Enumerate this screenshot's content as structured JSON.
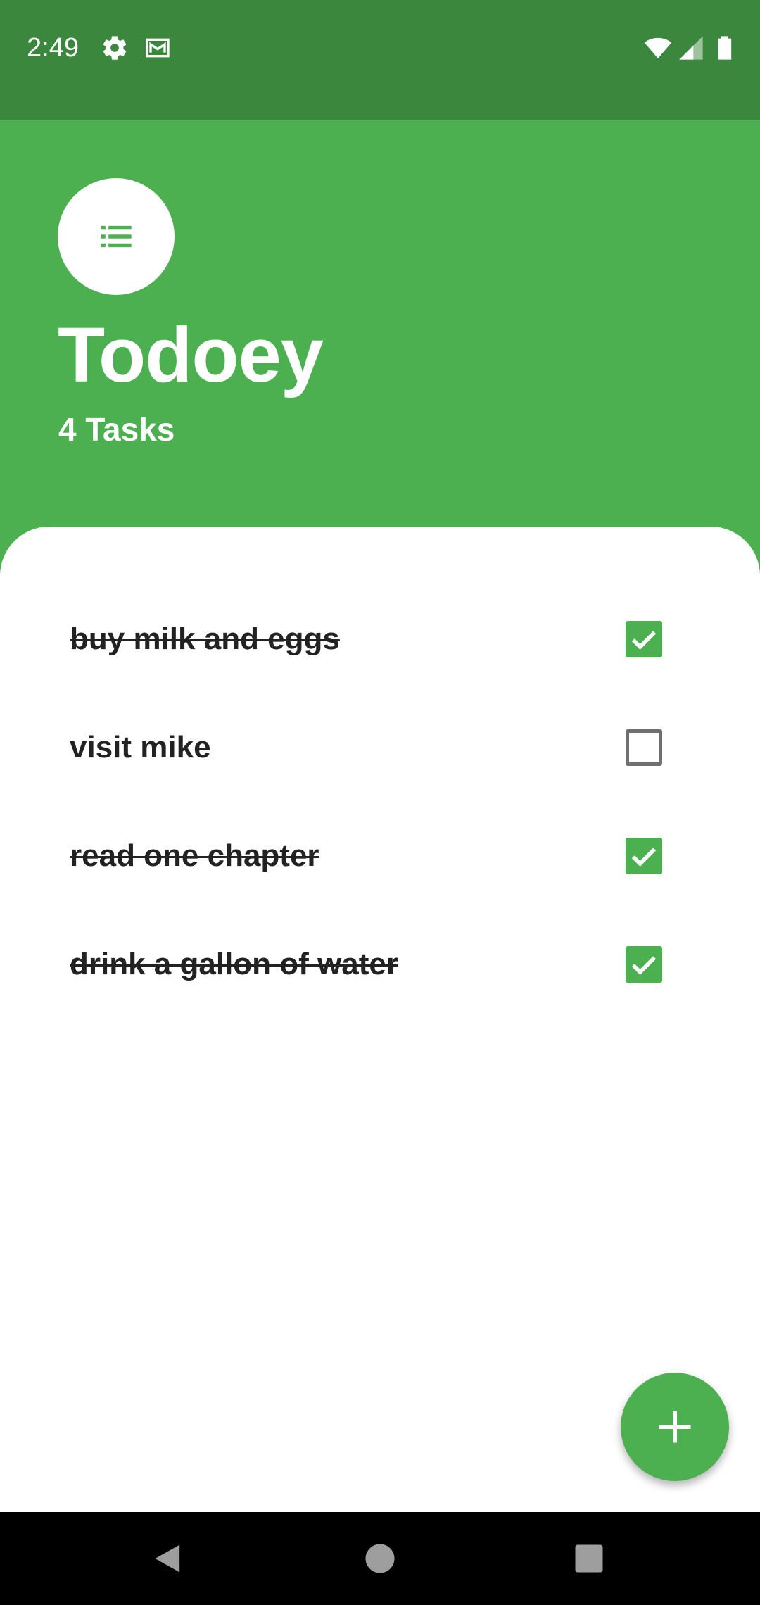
{
  "status_bar": {
    "time": "2:49",
    "icons": [
      "gear-icon",
      "gmail-icon",
      "wifi-icon",
      "signal-icon",
      "battery-icon"
    ]
  },
  "header": {
    "logo_icon": "list-icon",
    "title": "Todoey",
    "task_count": "4 Tasks"
  },
  "tasks": [
    {
      "label": "buy milk and eggs",
      "done": true
    },
    {
      "label": "visit mike",
      "done": false
    },
    {
      "label": "read one chapter",
      "done": true
    },
    {
      "label": "drink a gallon of water",
      "done": true
    }
  ],
  "fab": {
    "icon": "plus-icon"
  },
  "nav_bar": {
    "icons": [
      "back-icon",
      "home-icon",
      "recents-icon"
    ]
  },
  "colors": {
    "accent": "#4CAF50",
    "status_bar": "#3B873E",
    "text": "#222222",
    "unchecked_border": "#707070"
  }
}
